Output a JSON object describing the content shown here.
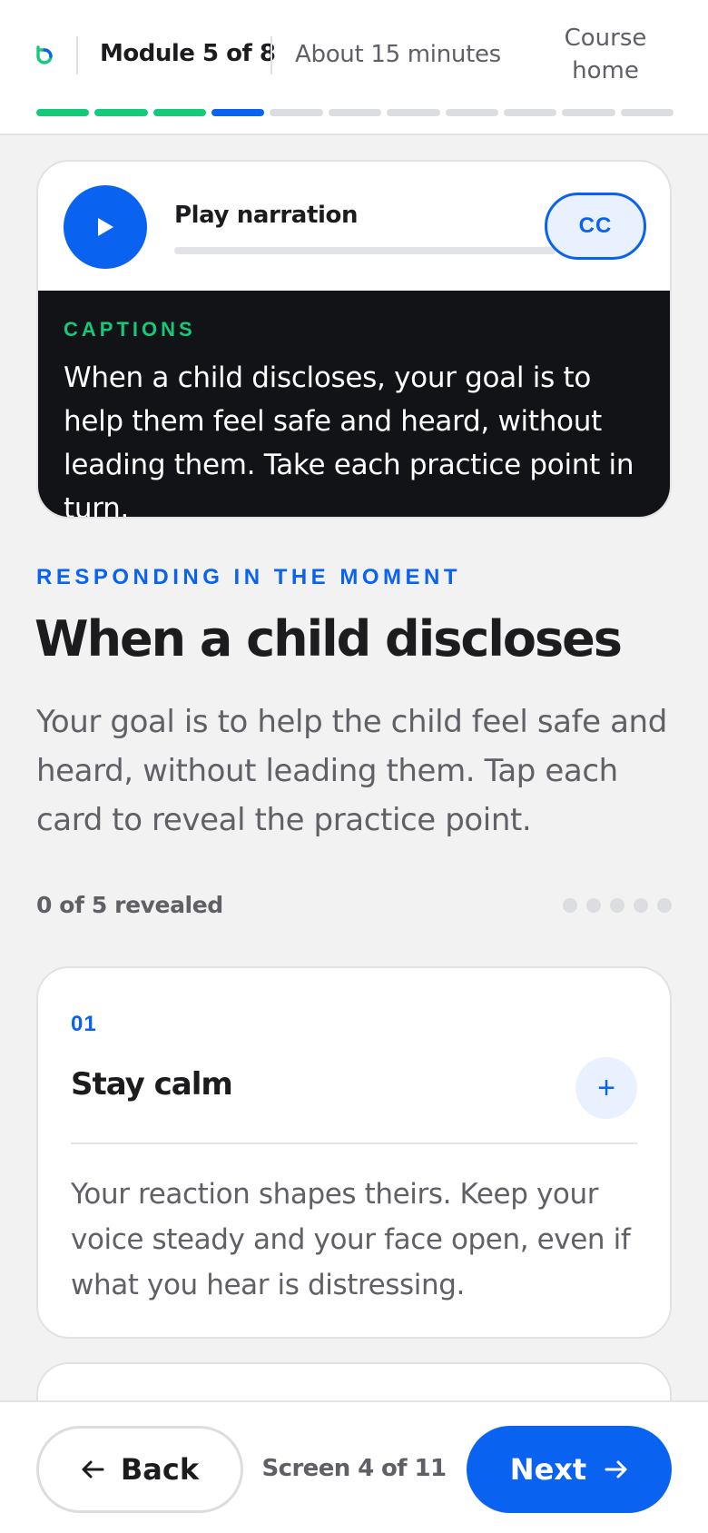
{
  "header": {
    "module": "Module 5 of 8",
    "duration": "About 15 minutes",
    "course_home": "Course home",
    "progress": {
      "total": 11,
      "completed": 3,
      "current": 4
    }
  },
  "narration": {
    "play_label": "Play narration",
    "cc_label": "CC",
    "progress_fraction": 0,
    "captions_label": "CAPTIONS",
    "captions_text": "When a child discloses, your goal is to help them feel safe and heard, without leading them. Take each practice point in turn."
  },
  "section": {
    "eyebrow": "RESPONDING IN THE MOMENT",
    "title": "When a child discloses",
    "description": "Your goal is to help the child feel safe and heard, without leading them. Tap each card to reveal the practice point.",
    "revealed_label": "0 of 5 revealed",
    "revealed_count": 0,
    "total_cards": 5
  },
  "cards": [
    {
      "number": "01",
      "title": "Stay calm",
      "expand_icon": "+",
      "body": "Your reaction shapes theirs. Keep your voice steady and your face open, even if what you hear is distressing."
    }
  ],
  "footer": {
    "back_label": "Back",
    "screen_label": "Screen 4 of 11",
    "next_label": "Next"
  },
  "colors": {
    "accent": "#0a62f0",
    "success": "#14c97a",
    "captions_bg": "#121316"
  }
}
